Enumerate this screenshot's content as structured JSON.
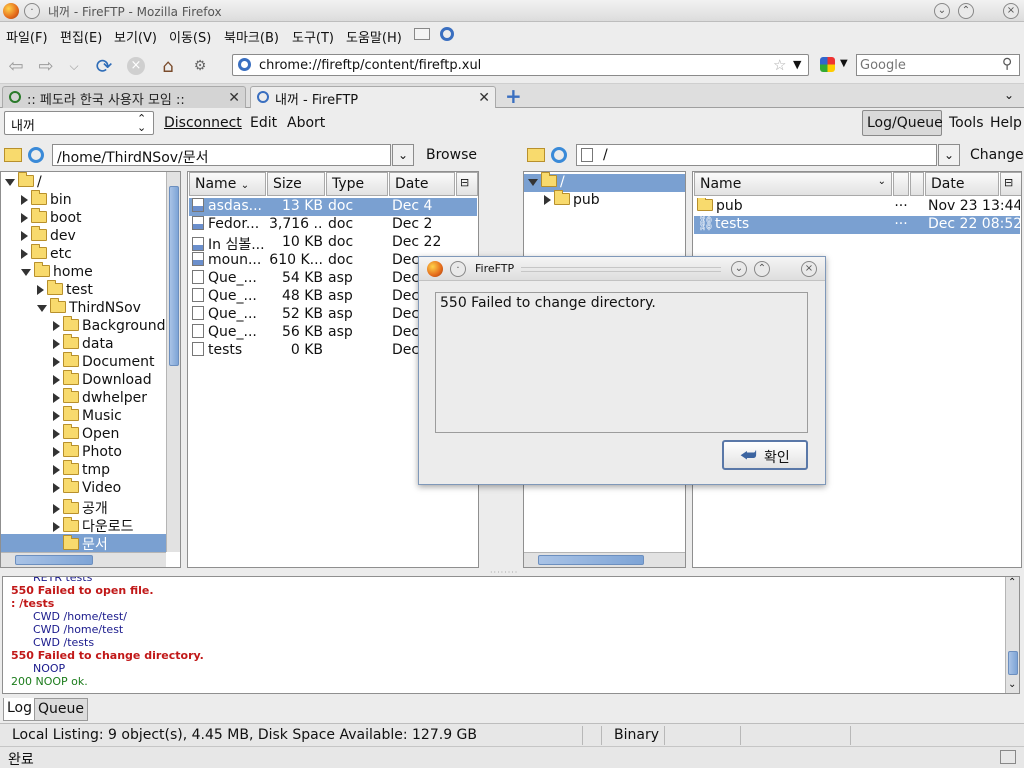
{
  "window": {
    "title": "내꺼 - FireFTP - Mozilla Firefox"
  },
  "menu": [
    "파일(F)",
    "편집(E)",
    "보기(V)",
    "이동(S)",
    "북마크(B)",
    "도구(T)",
    "도움말(H)"
  ],
  "nav": {
    "url": "chrome://fireftp/content/fireftp.xul",
    "search_placeholder": "Google"
  },
  "tabs": [
    {
      "label": ":: 페도라 한국 사용자 모임 ::",
      "active": false
    },
    {
      "label": "내꺼 - FireFTP",
      "active": true
    }
  ],
  "ftp_toolbar": {
    "account": "내꺼",
    "disconnect": "Disconnect",
    "edit": "Edit",
    "abort": "Abort",
    "log_queue": "Log/Queue",
    "tools": "Tools",
    "help": "Help"
  },
  "local": {
    "path": "/home/ThirdNSov/문서",
    "browse": "Browse",
    "tree": [
      {
        "label": "/",
        "depth": 0,
        "open": true
      },
      {
        "label": "bin",
        "depth": 1,
        "open": false
      },
      {
        "label": "boot",
        "depth": 1,
        "open": false
      },
      {
        "label": "dev",
        "depth": 1,
        "open": false
      },
      {
        "label": "etc",
        "depth": 1,
        "open": false
      },
      {
        "label": "home",
        "depth": 1,
        "open": true
      },
      {
        "label": "test",
        "depth": 2,
        "open": false
      },
      {
        "label": "ThirdNSov",
        "depth": 2,
        "open": true
      },
      {
        "label": "Background",
        "depth": 3,
        "open": false
      },
      {
        "label": "data",
        "depth": 3,
        "open": false
      },
      {
        "label": "Document",
        "depth": 3,
        "open": false
      },
      {
        "label": "Download",
        "depth": 3,
        "open": false
      },
      {
        "label": "dwhelper",
        "depth": 3,
        "open": false
      },
      {
        "label": "Music",
        "depth": 3,
        "open": false
      },
      {
        "label": "Open",
        "depth": 3,
        "open": false
      },
      {
        "label": "Photo",
        "depth": 3,
        "open": false
      },
      {
        "label": "tmp",
        "depth": 3,
        "open": false
      },
      {
        "label": "Video",
        "depth": 3,
        "open": false
      },
      {
        "label": "공개",
        "depth": 3,
        "open": false
      },
      {
        "label": "다운로드",
        "depth": 3,
        "open": false
      },
      {
        "label": "문서",
        "depth": 3,
        "open": false,
        "selected": true,
        "leaf": true
      }
    ],
    "columns": {
      "name": "Name",
      "size": "Size",
      "type": "Type",
      "date": "Date"
    },
    "files": [
      {
        "name": "asdas...",
        "size": "13 KB",
        "type": "doc",
        "date": "Dec 4",
        "icon": "doc",
        "selected": true
      },
      {
        "name": "Fedor...",
        "size": "3,716 ...",
        "type": "doc",
        "date": "Dec 2",
        "icon": "doc"
      },
      {
        "name": "In 심볼...",
        "size": "10 KB",
        "type": "doc",
        "date": "Dec 22",
        "icon": "doc"
      },
      {
        "name": "moun...",
        "size": "610 K...",
        "type": "doc",
        "date": "Dec",
        "icon": "doc"
      },
      {
        "name": "Que_...",
        "size": "54 KB",
        "type": "asp",
        "date": "Dec",
        "icon": "file"
      },
      {
        "name": "Que_...",
        "size": "48 KB",
        "type": "asp",
        "date": "Dec",
        "icon": "file"
      },
      {
        "name": "Que_...",
        "size": "52 KB",
        "type": "asp",
        "date": "Dec",
        "icon": "file"
      },
      {
        "name": "Que_...",
        "size": "56 KB",
        "type": "asp",
        "date": "Dec",
        "icon": "file"
      },
      {
        "name": "tests",
        "size": "0 KB",
        "type": "",
        "date": "Dec",
        "icon": "file"
      }
    ]
  },
  "remote": {
    "path": "/",
    "change": "Change",
    "tree": [
      {
        "label": "/",
        "depth": 0,
        "open": true,
        "selected": true
      },
      {
        "label": "pub",
        "depth": 1,
        "open": false
      }
    ],
    "columns": {
      "name": "Name",
      "date": "Date"
    },
    "files": [
      {
        "name": "pub",
        "more": "···",
        "date": "Nov 23 13:44",
        "icon": "folder"
      },
      {
        "name": "tests",
        "more": "···",
        "date": "Dec 22 08:52",
        "icon": "link",
        "selected": true
      }
    ]
  },
  "log": [
    {
      "text": "RETR tests",
      "kind": "cmd",
      "indent": true
    },
    {
      "text": "550 Failed to open file.",
      "kind": "err"
    },
    {
      "text": ": /tests",
      "kind": "err"
    },
    {
      "text": "CWD /home/test/",
      "kind": "cmd",
      "indent": true
    },
    {
      "text": "CWD /home/test",
      "kind": "cmd",
      "indent": true
    },
    {
      "text": "CWD /tests",
      "kind": "cmd",
      "indent": true
    },
    {
      "text": "550 Failed to change directory.",
      "kind": "err"
    },
    {
      "text": "NOOP",
      "kind": "cmd",
      "indent": true
    },
    {
      "text": "200 NOOP ok.",
      "kind": "ok"
    }
  ],
  "bottom_tabs": {
    "log": "Log",
    "queue": "Queue"
  },
  "status": {
    "listing": "Local Listing: 9 object(s), 4.45 MB, Disk Space Available: 127.9 GB",
    "mode": "Binary",
    "browser": "완료"
  },
  "dialog": {
    "title": "FireFTP",
    "message": "550 Failed to change directory.",
    "ok": "확인"
  }
}
